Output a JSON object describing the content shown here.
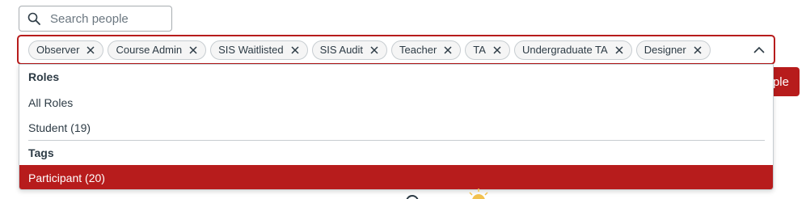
{
  "search": {
    "placeholder": "Search people",
    "value": ""
  },
  "role_filter": {
    "selected_tags": [
      "Observer",
      "Course Admin",
      "SIS Waitlisted",
      "SIS Audit",
      "Teacher",
      "TA",
      "Undergraduate TA",
      "Designer"
    ],
    "remove_icon": "close-icon",
    "toggle_icon": "chevron-up-icon"
  },
  "dropdown": {
    "groups": [
      {
        "label": "Roles",
        "options": [
          "All Roles",
          "Student (19)"
        ]
      },
      {
        "label": "Tags",
        "options": [
          "Participant (20)"
        ]
      }
    ],
    "highlighted_option": "Participant (20)"
  },
  "background_button": {
    "label": "ple"
  },
  "colors": {
    "accent": "#B71C1C",
    "text": "#2D3B45",
    "border": "#C7CDD1"
  }
}
